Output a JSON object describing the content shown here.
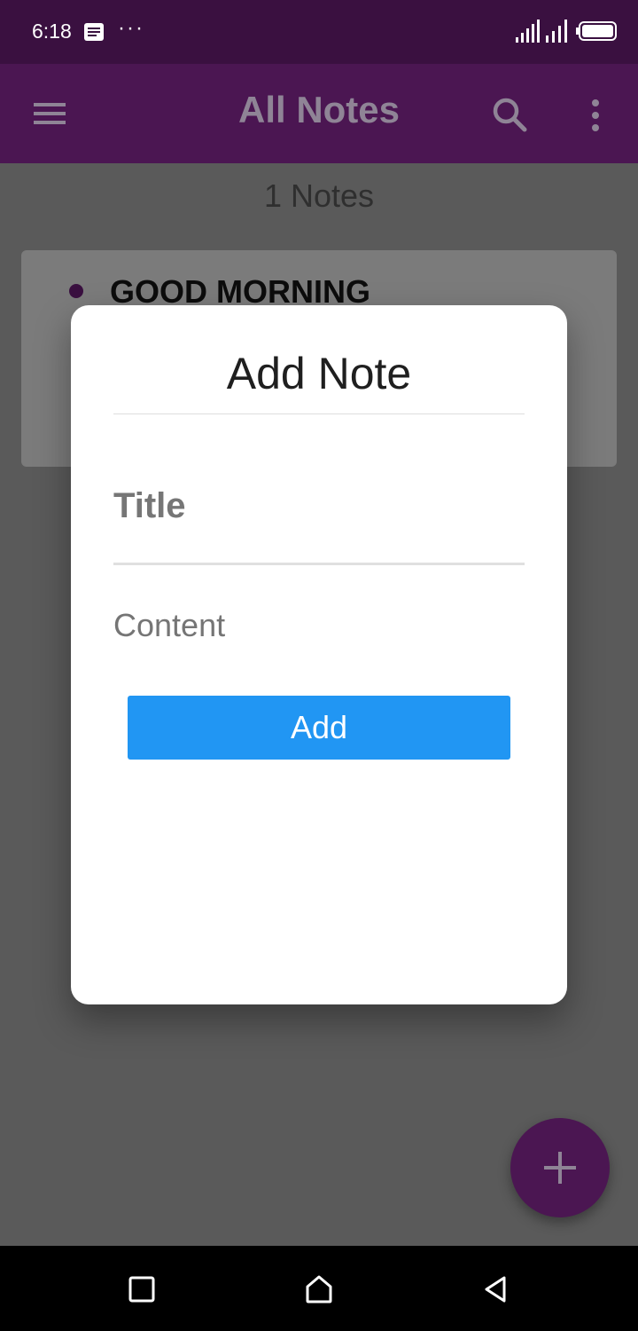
{
  "status_bar": {
    "time": "6:18",
    "icons": [
      "message-icon",
      "more-dots-icon",
      "signal-hd-icon",
      "signal-icon",
      "battery-icon"
    ],
    "overflow_dots": "···"
  },
  "app_bar": {
    "title": "All Notes",
    "icons": [
      "menu-icon",
      "search-icon",
      "more-vert-icon"
    ],
    "background": "#4b1652"
  },
  "notes_count": "1 Notes",
  "notes": [
    {
      "title": "GOOD MORNING"
    }
  ],
  "dialog": {
    "title": "Add Note",
    "title_field": {
      "placeholder": "Title",
      "value": ""
    },
    "content_field": {
      "placeholder": "Content",
      "value": ""
    },
    "add_button_label": "Add",
    "button_color": "#2196f3"
  },
  "fab": {
    "icon": "plus-icon",
    "color": "#4b1652"
  },
  "nav_bar": {
    "icons": [
      "recent-apps-icon",
      "home-icon",
      "back-icon"
    ]
  }
}
